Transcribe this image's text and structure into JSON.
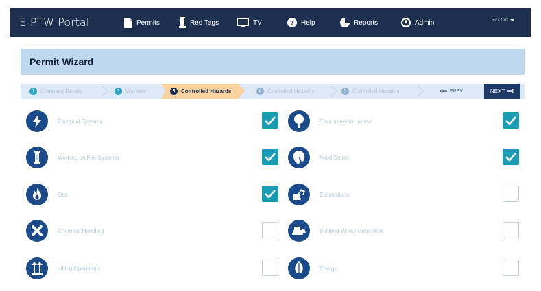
{
  "app": {
    "title": "E-PTW Portal",
    "user": "Rick Cox"
  },
  "nav": [
    {
      "label": "Permits",
      "icon": "document-icon"
    },
    {
      "label": "Red Tags",
      "icon": "tag-icon"
    },
    {
      "label": "TV",
      "icon": "monitor-icon"
    },
    {
      "label": "Help",
      "icon": "help-icon"
    },
    {
      "label": "Reports",
      "icon": "pie-chart-icon"
    },
    {
      "label": "Admin",
      "icon": "user-circle-icon"
    }
  ],
  "wizard": {
    "title": "Permit Wizard",
    "steps": [
      {
        "number": "1",
        "label": "Company Details",
        "state": "done"
      },
      {
        "number": "2",
        "label": "Workers",
        "state": "done"
      },
      {
        "number": "3",
        "label": "Controlled Hazards",
        "state": "active"
      },
      {
        "number": "4",
        "label": "Controlled Hazards",
        "state": "upcoming"
      },
      {
        "number": "5",
        "label": "Controlled Hazards",
        "state": "upcoming"
      }
    ],
    "prev_label": "PREV",
    "next_label": "NEXT"
  },
  "hazards": [
    {
      "label": "Electrical Systems",
      "icon": "lightning-icon",
      "checked": true
    },
    {
      "label": "Environmental Impact",
      "icon": "tree-icon",
      "checked": true
    },
    {
      "label": "Working on Fire Systems",
      "icon": "fire-extinguisher-icon",
      "checked": true
    },
    {
      "label": "Food Safety",
      "icon": "food-icon",
      "checked": true
    },
    {
      "label": "Gas",
      "icon": "flame-icon",
      "checked": true
    },
    {
      "label": "Excavations",
      "icon": "excavator-icon",
      "checked": false
    },
    {
      "label": "Chemical Handling",
      "icon": "cross-icon",
      "checked": false
    },
    {
      "label": "Building Work / Demolition",
      "icon": "bulldozer-icon",
      "checked": false
    },
    {
      "label": "Lifting Operations",
      "icon": "lifting-arrows-icon",
      "checked": false
    },
    {
      "label": "Energy",
      "icon": "leaf-icon",
      "checked": false
    }
  ],
  "colors": {
    "topbar": "#1d2f4f",
    "accent": "#1c9cb3",
    "active_step": "#f8d3a0",
    "icon_bg": "#1a4a8a"
  }
}
